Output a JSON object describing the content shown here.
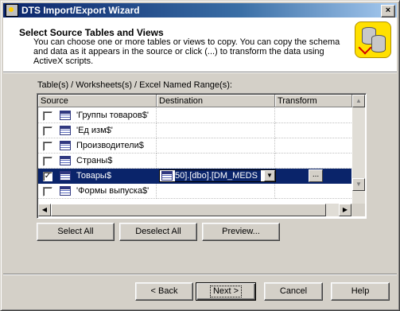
{
  "window": {
    "title": "DTS Import/Export Wizard",
    "close_glyph": "×"
  },
  "header": {
    "title": "Select Source Tables and Views",
    "description": "You can choose one or more tables or views to copy.  You can copy the schema and data as it appears in the source or click (...) to transform the data using ActiveX scripts."
  },
  "list_label": "Table(s) / Worksheets(s) / Excel Named Range(s):",
  "grid": {
    "columns": [
      "Source",
      "Destination",
      "Transform"
    ],
    "rows": [
      {
        "source": "'Группы товаров$'",
        "checked": false
      },
      {
        "source": "'Ед изм$'",
        "checked": false
      },
      {
        "source": "Производители$",
        "checked": false
      },
      {
        "source": "Страны$",
        "checked": false
      },
      {
        "source": "Товары$",
        "checked": true,
        "selected": true,
        "destination": "50].[dbo].[DM_MEDS",
        "transform": "..."
      },
      {
        "source": "'Формы выпуска$'",
        "checked": false
      }
    ]
  },
  "buttons": {
    "select_all": "Select All",
    "deselect_all": "Deselect All",
    "preview": "Preview...",
    "back": "< Back",
    "next": "Next >",
    "cancel": "Cancel",
    "help": "Help"
  }
}
